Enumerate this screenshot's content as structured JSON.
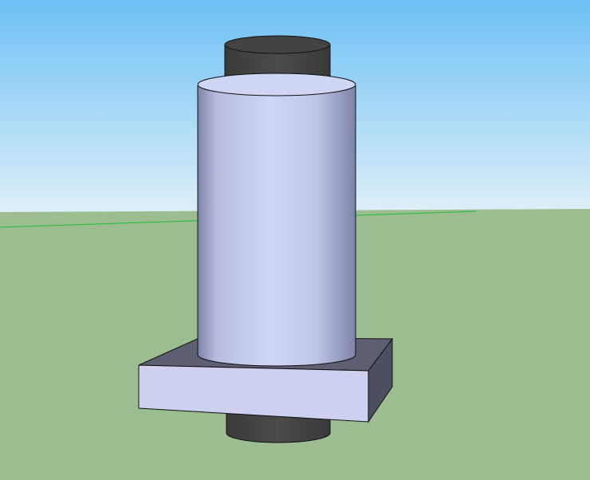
{
  "viewport": {
    "kind": "3d-modeling-viewport",
    "colors": {
      "sky_top": "#6cc0f4",
      "sky_horizon": "#dff0f8",
      "ground": "#9bbd8f",
      "axis_green": "#1fbf3a",
      "cylinder_light": "#cfd6f4",
      "cylinder_dark": "#7d82a8",
      "base_front": "#cdd0ee",
      "base_top": "#5d6072",
      "base_side": "#4c4f5f",
      "shaft": "#474747",
      "edge": "#111111"
    }
  },
  "model": {
    "objects": [
      {
        "name": "shaft",
        "shape": "cylinder",
        "color_key": "shaft"
      },
      {
        "name": "main-cylinder",
        "shape": "cylinder",
        "color_key": "cylinder_light"
      },
      {
        "name": "base-plate",
        "shape": "box",
        "color_key": "base_front"
      }
    ]
  }
}
